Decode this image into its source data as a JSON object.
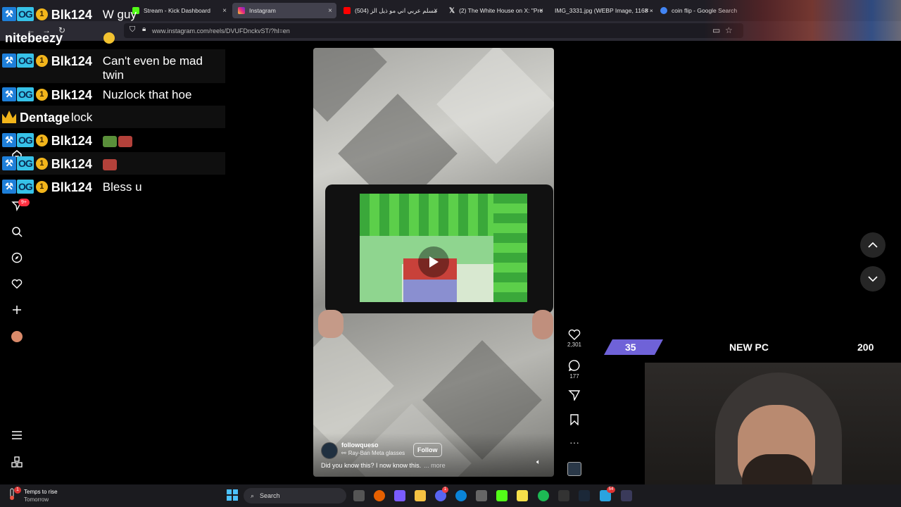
{
  "browser": {
    "tabs": [
      {
        "label": "Stream - Kick Dashboard",
        "favicon_color": "#53fc18",
        "active": false
      },
      {
        "label": "Instagram",
        "favicon_color": "#e1306c",
        "active": true
      },
      {
        "label": "(504) مسلم عربي اني مو ذيل الز",
        "favicon_color": "#ff0000",
        "active": false
      },
      {
        "label": "(2) The White House on X: \"Pre",
        "favicon_color": "#ffffff",
        "active": false
      },
      {
        "label": "IMG_3331.jpg (WEBP Image, 1168 ×",
        "favicon_color": "#888888",
        "active": false
      },
      {
        "label": "coin flip - Google Search",
        "favicon_color": "#4285f4",
        "active": false
      }
    ],
    "url": "www.instagram.com/reels/DVUFDnckvST/?hl=en",
    "close_glyph": "×"
  },
  "chat": {
    "messages": [
      {
        "user": "Blk124",
        "badges": [
          "mod",
          "og",
          "sub"
        ],
        "sub_months": "1",
        "text": "W guy"
      },
      {
        "user": "nitebeezy",
        "badges": [],
        "text": ""
      },
      {
        "user": "Blk124",
        "badges": [
          "mod",
          "og",
          "sub"
        ],
        "sub_months": "1",
        "text": "Can't even be mad twin"
      },
      {
        "user": "Blk124",
        "badges": [
          "mod",
          "og",
          "sub"
        ],
        "sub_months": "1",
        "text": "Nuzlock that hoe"
      },
      {
        "user": "Dentage",
        "badges": [
          "crown"
        ],
        "text": "lock"
      },
      {
        "user": "Blk124",
        "badges": [
          "mod",
          "og",
          "sub"
        ],
        "sub_months": "1",
        "text": ""
      },
      {
        "user": "Blk124",
        "badges": [
          "mod",
          "og",
          "sub"
        ],
        "sub_months": "1",
        "text": ""
      },
      {
        "user": "Blk124",
        "badges": [
          "mod",
          "og",
          "sub"
        ],
        "sub_months": "1",
        "text": "Bless u"
      }
    ],
    "badge_og_label": "OG"
  },
  "instagram": {
    "notification_count": "9+",
    "reel": {
      "author": "followqueso",
      "audio": "Ray-Ban Meta glasses",
      "follow_label": "Follow",
      "caption": "Did you know this? I now know this.",
      "more_label": "... more",
      "likes": "2,301",
      "comments": "177"
    }
  },
  "overlay": {
    "left_value": "35",
    "title": "NEW PC",
    "right_value": "200"
  },
  "taskbar": {
    "weather_title": "Temps to rise",
    "weather_sub": "Tomorrow",
    "weather_badge": "1",
    "search_placeholder": "Search",
    "discord_badge": "1",
    "telegram_badge": "54"
  },
  "colors": {
    "accent_blue": "#1e7fd9",
    "og_cyan": "#36c2e8",
    "sub_gold": "#f2b51b",
    "overlay_purple": "#6f62d8",
    "notification_red": "#ff3040"
  }
}
